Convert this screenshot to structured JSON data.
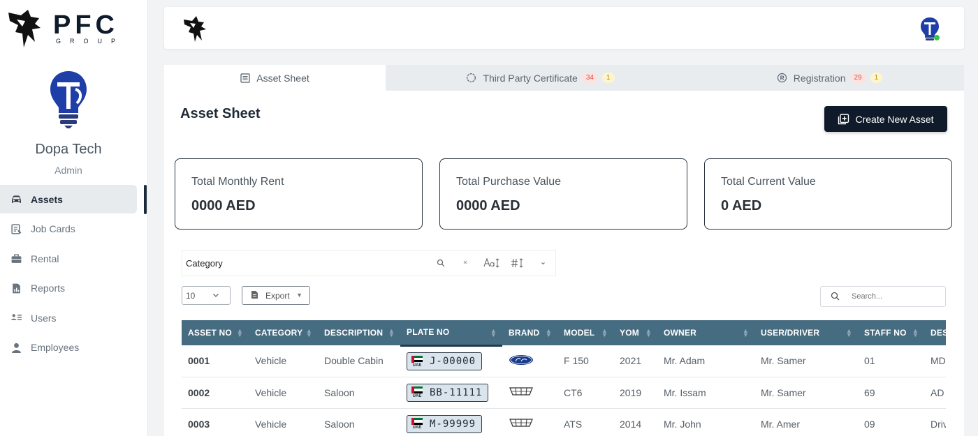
{
  "sidebar": {
    "logo_text": "PFC",
    "logo_sub": "GROUP",
    "user_name": "Dopa Tech",
    "user_role": "Admin",
    "items": [
      {
        "label": "Assets",
        "icon": "car-icon",
        "active": true
      },
      {
        "label": "Job Cards",
        "icon": "job-card-icon",
        "active": false
      },
      {
        "label": "Rental",
        "icon": "briefcase-icon",
        "active": false
      },
      {
        "label": "Reports",
        "icon": "report-icon",
        "active": false
      },
      {
        "label": "Users",
        "icon": "users-list-icon",
        "active": false
      },
      {
        "label": "Employees",
        "icon": "person-icon",
        "active": false
      }
    ]
  },
  "tabs": [
    {
      "label": "Asset Sheet",
      "icon": "sheet-icon",
      "active": true
    },
    {
      "label": "Third Party Certificate",
      "icon": "certificate-icon",
      "badge_red": "34",
      "badge_yellow": "1"
    },
    {
      "label": "Registration",
      "icon": "registered-icon",
      "badge_red": "29",
      "badge_yellow": "1"
    }
  ],
  "main": {
    "title": "Asset Sheet",
    "create_button": "Create New Asset",
    "stats": [
      {
        "label": "Total Monthly Rent",
        "value": "0000 AED"
      },
      {
        "label": "Total Purchase Value",
        "value": "0000 AED"
      },
      {
        "label": "Total Current Value",
        "value": "0 AED"
      }
    ],
    "filter": {
      "column": "Category"
    },
    "page_size": "10",
    "export_label": "Export",
    "search_placeholder": "Search..."
  },
  "table": {
    "headers": [
      "ASSET NO",
      "CATEGORY",
      "DESCRIPTION",
      "PLATE NO",
      "BRAND",
      "MODEL",
      "YOM",
      "OWNER",
      "USER/DRIVER",
      "STAFF NO",
      "DES"
    ],
    "rows": [
      {
        "asset_no": "0001",
        "category": "Vehicle",
        "description": "Double Cabin",
        "plate": "J-00000",
        "plate_tag": "UAE",
        "brand": "ford-logo",
        "model": "F 150",
        "yom": "2021",
        "owner": "Mr. Adam",
        "driver": "Mr. Samer",
        "staff_no": "01",
        "des": "MD"
      },
      {
        "asset_no": "0002",
        "category": "Vehicle",
        "description": "Saloon",
        "plate": "BB-11111",
        "plate_tag": "UAE",
        "brand": "cadillac-logo",
        "model": "CT6",
        "yom": "2019",
        "owner": "Mr. Issam",
        "driver": "Mr. Samer",
        "staff_no": "69",
        "des": "AD"
      },
      {
        "asset_no": "0003",
        "category": "Vehicle",
        "description": "Saloon",
        "plate": "M-99999",
        "plate_tag": "UAE",
        "brand": "cadillac-logo",
        "model": "ATS",
        "yom": "2014",
        "owner": "Mr. John",
        "driver": "Mr. Amer",
        "staff_no": "09",
        "des": "Driv"
      }
    ]
  },
  "colors": {
    "header_bg": "#466c82",
    "primary_dark": "#0f1b2a",
    "badge_red": "#d9534f",
    "online": "#3cc44a"
  }
}
